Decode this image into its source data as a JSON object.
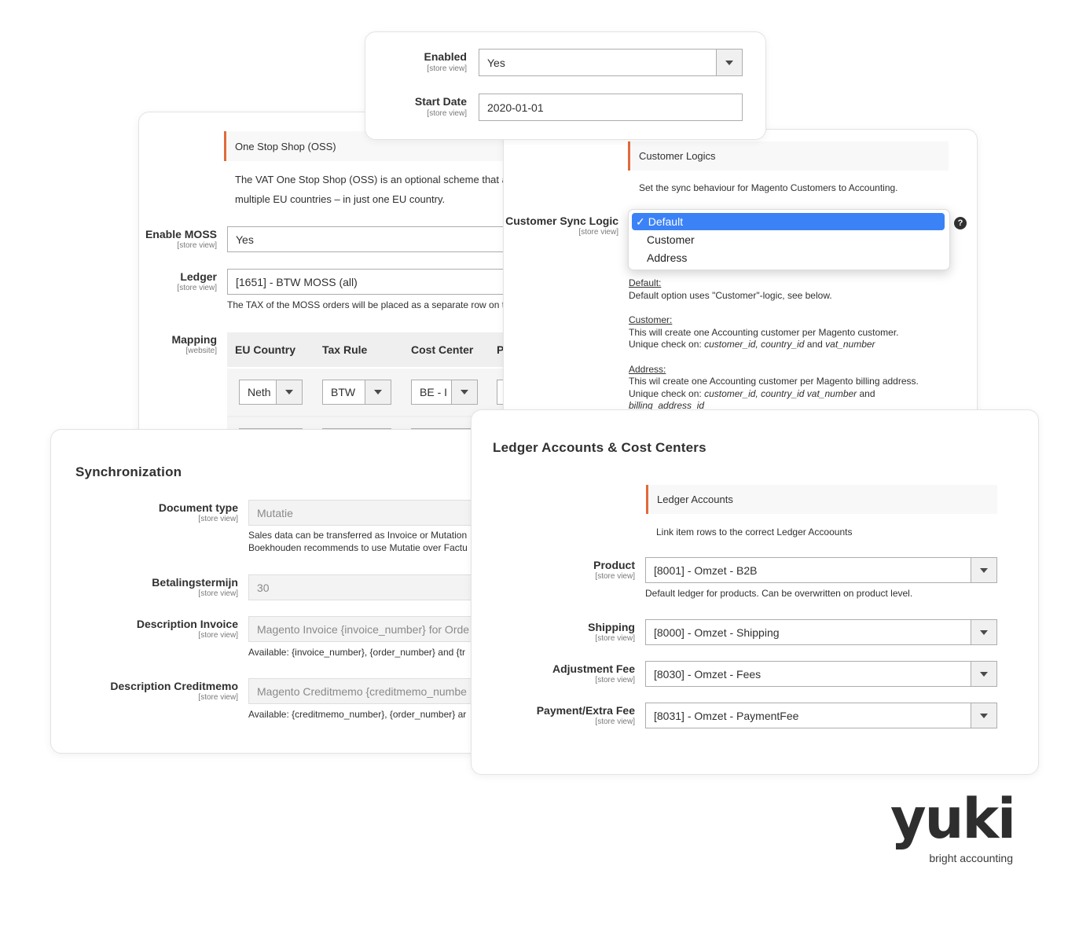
{
  "top_card": {
    "enabled": {
      "label": "Enabled",
      "scope": "[store view]",
      "value": "Yes"
    },
    "start_date": {
      "label": "Start Date",
      "scope": "[store view]",
      "value": "2020-01-01"
    }
  },
  "oss_card": {
    "section_title": "One Stop Shop (OSS)",
    "description_line1": "The VAT One Stop Shop (OSS) is an optional scheme that allo",
    "description_line2": "multiple EU countries – in just one EU country.",
    "enable_moss": {
      "label": "Enable MOSS",
      "scope": "[store view]",
      "value": "Yes"
    },
    "ledger": {
      "label": "Ledger",
      "scope": "[store view]",
      "value": "[1651] - BTW MOSS (all)",
      "note": "The TAX of the MOSS orders will be placed as a separate row on t"
    },
    "mapping": {
      "label": "Mapping",
      "scope": "[website]",
      "columns": [
        "EU Country",
        "Tax Rule",
        "Cost Center",
        "P"
      ],
      "row": {
        "country": "Neth",
        "tax_rule": "BTW",
        "cost_center": "BE - I"
      }
    }
  },
  "customer_card": {
    "section_title": "Customer Logics",
    "section_desc": "Set the sync behaviour for Magento Customers to Accounting.",
    "sync_logic": {
      "label": "Customer Sync Logic",
      "scope": "[store view]"
    },
    "dropdown": {
      "options": [
        "Default",
        "Customer",
        "Address"
      ],
      "selected": "Default",
      "check": "✓"
    },
    "help_icon": "?",
    "help": {
      "default_title": "Default:",
      "default_text": "Default option uses \"Customer\"-logic, see below.",
      "customer_title": "Customer:",
      "customer_text": "This will create one Accounting customer per Magento customer.",
      "customer_unique_prefix": "Unique check on: ",
      "customer_unique_fields": "customer_id, country_id",
      "customer_unique_and": " and ",
      "customer_unique_last": "vat_number",
      "address_title": "Address:",
      "address_text": "This wil create one Accounting customer per Magento billing address.",
      "address_unique_prefix": "Unique check on: ",
      "address_unique_fields": "customer_id, country_id vat_number",
      "address_unique_and": " and",
      "address_unique_last": "billing_address_id"
    }
  },
  "sync_card": {
    "title": "Synchronization",
    "document_type": {
      "label": "Document type",
      "scope": "[store view]",
      "value": "Mutatie",
      "note_line1": "Sales data can be transferred as Invoice or Mutation",
      "note_line2": "Boekhouden recommends to use Mutatie over Factu"
    },
    "betalingstermijn": {
      "label": "Betalingstermijn",
      "scope": "[store view]",
      "value": "30"
    },
    "description_invoice": {
      "label": "Description Invoice",
      "scope": "[store view]",
      "value": "Magento Invoice {invoice_number} for Orde",
      "note": "Available: {invoice_number}, {order_number} and {tr"
    },
    "description_creditmemo": {
      "label": "Description Creditmemo",
      "scope": "[store view]",
      "value": "Magento Creditmemo {creditmemo_numbe",
      "note": "Available: {creditmemo_number}, {order_number} ar"
    }
  },
  "ledger_card": {
    "title": "Ledger Accounts & Cost Centers",
    "section_title": "Ledger Accounts",
    "section_desc": "Link item rows to the correct Ledger Accoounts",
    "product": {
      "label": "Product",
      "scope": "[store view]",
      "value": "[8001] - Omzet - B2B",
      "note": "Default ledger for products. Can be overwritten on product level."
    },
    "shipping": {
      "label": "Shipping",
      "scope": "[store view]",
      "value": "[8000] - Omzet - Shipping"
    },
    "adjustment_fee": {
      "label": "Adjustment Fee",
      "scope": "[store view]",
      "value": "[8030] - Omzet - Fees"
    },
    "payment_fee": {
      "label": "Payment/Extra Fee",
      "scope": "[store view]",
      "value": "[8031] - Omzet - PaymentFee"
    }
  },
  "brand": {
    "name": "yuki",
    "tagline": "bright accounting"
  },
  "colors": {
    "accent": "#e06a3b",
    "selection": "#3b82f6",
    "text": "#303030"
  }
}
